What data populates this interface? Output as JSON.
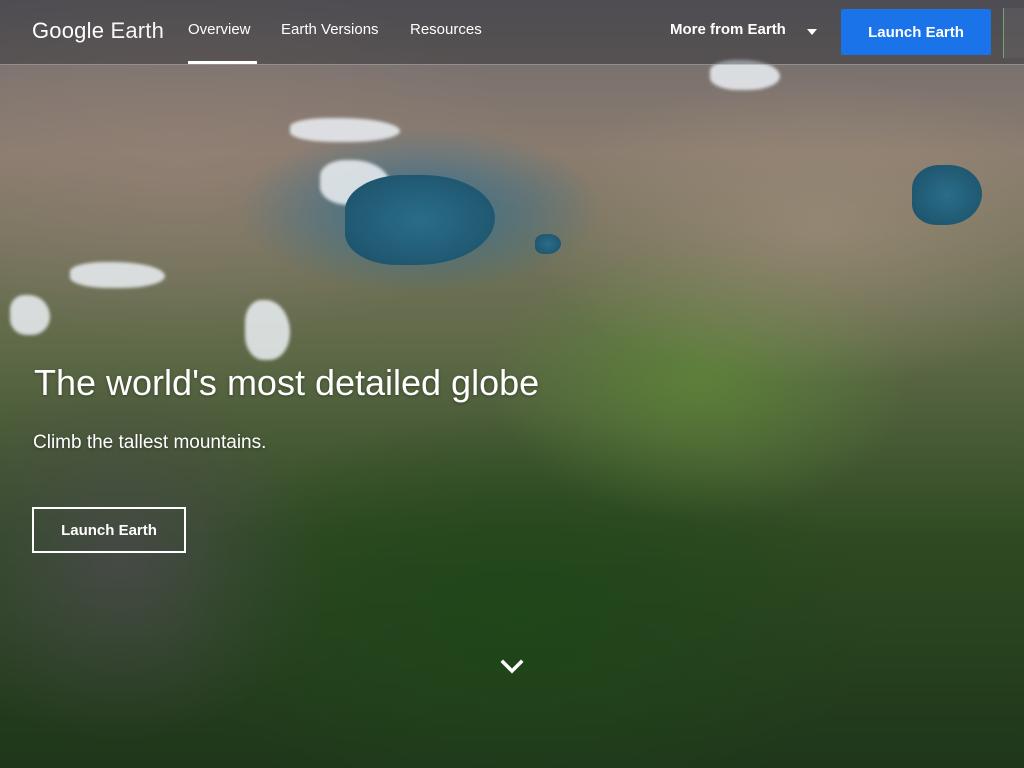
{
  "header": {
    "logo": {
      "brand": "Google",
      "product": "Earth"
    },
    "nav": [
      {
        "label": "Overview",
        "active": true
      },
      {
        "label": "Earth Versions",
        "active": false
      },
      {
        "label": "Resources",
        "active": false
      }
    ],
    "more_label": "More from Earth",
    "launch_label": "Launch Earth"
  },
  "hero": {
    "title": "The world's most detailed globe",
    "subtitle": "Climb the tallest mountains.",
    "launch_label": "Launch Earth"
  },
  "icons": {
    "dropdown": "caret-down-icon",
    "scroll": "chevron-down-icon"
  },
  "colors": {
    "launch_button": "#1a73e8",
    "text": "#ffffff"
  }
}
